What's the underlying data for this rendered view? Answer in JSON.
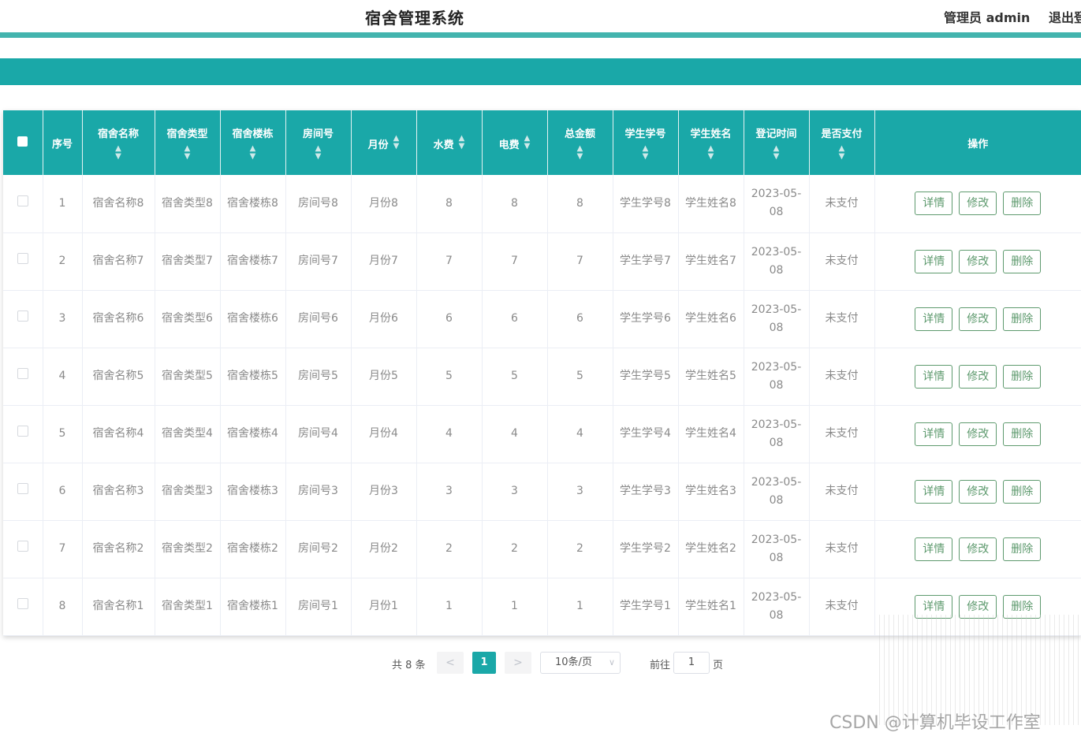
{
  "header": {
    "title": "宿舍管理系统",
    "user": "管理员 admin",
    "logout": "退出登"
  },
  "table": {
    "columns": [
      "序号",
      "宿舍名称",
      "宿舍类型",
      "宿舍楼栋",
      "房间号",
      "月份",
      "水费",
      "电费",
      "总金额",
      "学生学号",
      "学生姓名",
      "登记时间",
      "是否支付",
      "操作"
    ],
    "rows": [
      {
        "no": "1",
        "name": "宿舍名称8",
        "type": "宿舍类型8",
        "building": "宿舍楼栋8",
        "room": "房间号8",
        "month": "月份8",
        "water": "8",
        "power": "8",
        "total": "8",
        "sid": "学生学号8",
        "sname": "学生姓名8",
        "date": "2023-05-08",
        "paid": "未支付"
      },
      {
        "no": "2",
        "name": "宿舍名称7",
        "type": "宿舍类型7",
        "building": "宿舍楼栋7",
        "room": "房间号7",
        "month": "月份7",
        "water": "7",
        "power": "7",
        "total": "7",
        "sid": "学生学号7",
        "sname": "学生姓名7",
        "date": "2023-05-08",
        "paid": "未支付"
      },
      {
        "no": "3",
        "name": "宿舍名称6",
        "type": "宿舍类型6",
        "building": "宿舍楼栋6",
        "room": "房间号6",
        "month": "月份6",
        "water": "6",
        "power": "6",
        "total": "6",
        "sid": "学生学号6",
        "sname": "学生姓名6",
        "date": "2023-05-08",
        "paid": "未支付"
      },
      {
        "no": "4",
        "name": "宿舍名称5",
        "type": "宿舍类型5",
        "building": "宿舍楼栋5",
        "room": "房间号5",
        "month": "月份5",
        "water": "5",
        "power": "5",
        "total": "5",
        "sid": "学生学号5",
        "sname": "学生姓名5",
        "date": "2023-05-08",
        "paid": "未支付"
      },
      {
        "no": "5",
        "name": "宿舍名称4",
        "type": "宿舍类型4",
        "building": "宿舍楼栋4",
        "room": "房间号4",
        "month": "月份4",
        "water": "4",
        "power": "4",
        "total": "4",
        "sid": "学生学号4",
        "sname": "学生姓名4",
        "date": "2023-05-08",
        "paid": "未支付"
      },
      {
        "no": "6",
        "name": "宿舍名称3",
        "type": "宿舍类型3",
        "building": "宿舍楼栋3",
        "room": "房间号3",
        "month": "月份3",
        "water": "3",
        "power": "3",
        "total": "3",
        "sid": "学生学号3",
        "sname": "学生姓名3",
        "date": "2023-05-08",
        "paid": "未支付"
      },
      {
        "no": "7",
        "name": "宿舍名称2",
        "type": "宿舍类型2",
        "building": "宿舍楼栋2",
        "room": "房间号2",
        "month": "月份2",
        "water": "2",
        "power": "2",
        "total": "2",
        "sid": "学生学号2",
        "sname": "学生姓名2",
        "date": "2023-05-08",
        "paid": "未支付"
      },
      {
        "no": "8",
        "name": "宿舍名称1",
        "type": "宿舍类型1",
        "building": "宿舍楼栋1",
        "room": "房间号1",
        "month": "月份1",
        "water": "1",
        "power": "1",
        "total": "1",
        "sid": "学生学号1",
        "sname": "学生姓名1",
        "date": "2023-05-08",
        "paid": "未支付"
      }
    ],
    "actions": {
      "detail": "详情",
      "edit": "修改",
      "delete": "删除"
    }
  },
  "pagination": {
    "total": "共 8 条",
    "prev": "<",
    "next": ">",
    "current_page": "1",
    "page_size": "10条/页",
    "goto_label": "前往",
    "goto_value": "1",
    "goto_unit": "页"
  },
  "watermark": "CSDN @计算机毕设工作室",
  "colors": {
    "primary": "#1aa8a8",
    "accent_line": "#43b4ae",
    "action": "#5e9a6e"
  }
}
